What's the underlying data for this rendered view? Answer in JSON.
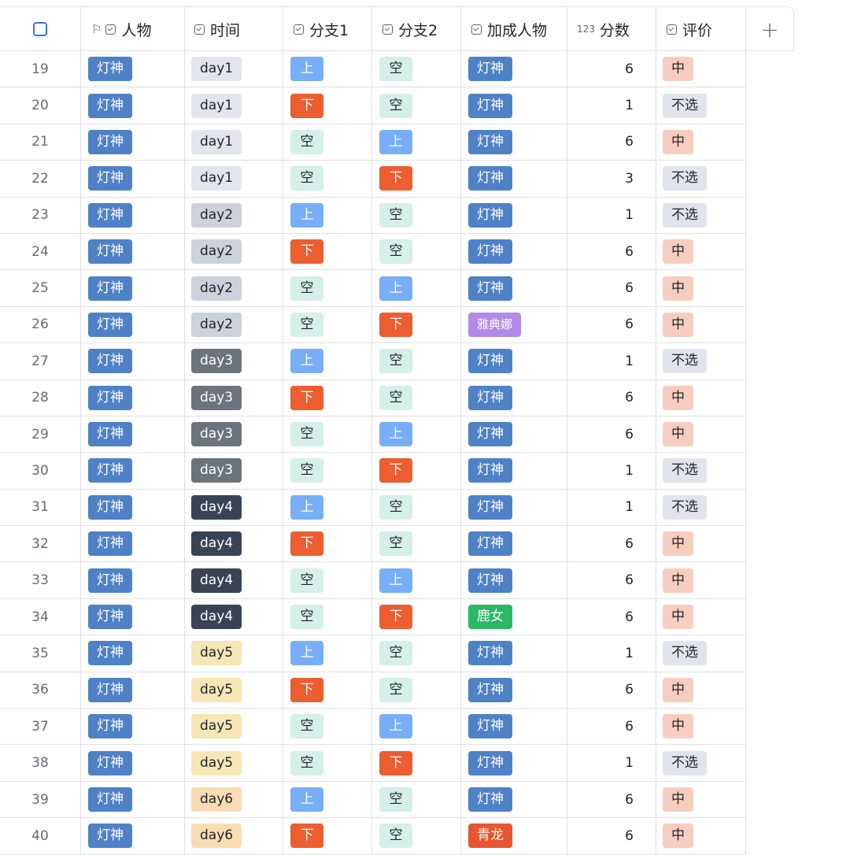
{
  "header": {
    "columns": [
      {
        "key": "select",
        "label": ""
      },
      {
        "key": "person",
        "label": "人物"
      },
      {
        "key": "time",
        "label": "时间"
      },
      {
        "key": "branch1",
        "label": "分支1"
      },
      {
        "key": "branch2",
        "label": "分支2"
      },
      {
        "key": "bonus",
        "label": "加成人物"
      },
      {
        "key": "score",
        "label": "分数",
        "type_icon": "123"
      },
      {
        "key": "rating",
        "label": "评价"
      },
      {
        "key": "add",
        "label": "+"
      }
    ]
  },
  "tag_colors": {
    "灯神": {
      "bg": "#4f81c7",
      "fg": "#ffffff"
    },
    "雅典娜": {
      "bg": "#b28ae8",
      "fg": "#ffffff"
    },
    "鹿女": {
      "bg": "#2bb866",
      "fg": "#ffffff"
    },
    "青龙": {
      "bg": "#e8562f",
      "fg": "#ffffff"
    },
    "day1": {
      "bg": "#e2e6ec",
      "fg": "#1f2329"
    },
    "day2": {
      "bg": "#cdd1d9",
      "fg": "#1f2329"
    },
    "day3": {
      "bg": "#6c737d",
      "fg": "#ffffff"
    },
    "day4": {
      "bg": "#384356",
      "fg": "#ffffff"
    },
    "day5": {
      "bg": "#f6e7b5",
      "fg": "#1f2329"
    },
    "day6": {
      "bg": "#fadcb2",
      "fg": "#1f2329"
    },
    "上": {
      "bg": "#78aef8",
      "fg": "#ffffff"
    },
    "下": {
      "bg": "#ec5d30",
      "fg": "#ffffff"
    },
    "空": {
      "bg": "#d5efe9",
      "fg": "#1f2329"
    },
    "中": {
      "bg": "#f7cdc0",
      "fg": "#1f2329"
    },
    "不选": {
      "bg": "#e1e5eb",
      "fg": "#1f2329"
    }
  },
  "rows": [
    {
      "num": "19",
      "person": "灯神",
      "time": "day1",
      "b1": "上",
      "b2": "空",
      "bonus": "灯神",
      "score": "6",
      "rating": "中"
    },
    {
      "num": "20",
      "person": "灯神",
      "time": "day1",
      "b1": "下",
      "b2": "空",
      "bonus": "灯神",
      "score": "1",
      "rating": "不选"
    },
    {
      "num": "21",
      "person": "灯神",
      "time": "day1",
      "b1": "空",
      "b2": "上",
      "bonus": "灯神",
      "score": "6",
      "rating": "中"
    },
    {
      "num": "22",
      "person": "灯神",
      "time": "day1",
      "b1": "空",
      "b2": "下",
      "bonus": "灯神",
      "score": "3",
      "rating": "不选"
    },
    {
      "num": "23",
      "person": "灯神",
      "time": "day2",
      "b1": "上",
      "b2": "空",
      "bonus": "灯神",
      "score": "1",
      "rating": "不选"
    },
    {
      "num": "24",
      "person": "灯神",
      "time": "day2",
      "b1": "下",
      "b2": "空",
      "bonus": "灯神",
      "score": "6",
      "rating": "中"
    },
    {
      "num": "25",
      "person": "灯神",
      "time": "day2",
      "b1": "空",
      "b2": "上",
      "bonus": "灯神",
      "score": "6",
      "rating": "中"
    },
    {
      "num": "26",
      "person": "灯神",
      "time": "day2",
      "b1": "空",
      "b2": "下",
      "bonus": "雅典娜",
      "score": "6",
      "rating": "中"
    },
    {
      "num": "27",
      "person": "灯神",
      "time": "day3",
      "b1": "上",
      "b2": "空",
      "bonus": "灯神",
      "score": "1",
      "rating": "不选"
    },
    {
      "num": "28",
      "person": "灯神",
      "time": "day3",
      "b1": "下",
      "b2": "空",
      "bonus": "灯神",
      "score": "6",
      "rating": "中"
    },
    {
      "num": "29",
      "person": "灯神",
      "time": "day3",
      "b1": "空",
      "b2": "上",
      "bonus": "灯神",
      "score": "6",
      "rating": "中"
    },
    {
      "num": "30",
      "person": "灯神",
      "time": "day3",
      "b1": "空",
      "b2": "下",
      "bonus": "灯神",
      "score": "1",
      "rating": "不选"
    },
    {
      "num": "31",
      "person": "灯神",
      "time": "day4",
      "b1": "上",
      "b2": "空",
      "bonus": "灯神",
      "score": "1",
      "rating": "不选"
    },
    {
      "num": "32",
      "person": "灯神",
      "time": "day4",
      "b1": "下",
      "b2": "空",
      "bonus": "灯神",
      "score": "6",
      "rating": "中"
    },
    {
      "num": "33",
      "person": "灯神",
      "time": "day4",
      "b1": "空",
      "b2": "上",
      "bonus": "灯神",
      "score": "6",
      "rating": "中"
    },
    {
      "num": "34",
      "person": "灯神",
      "time": "day4",
      "b1": "空",
      "b2": "下",
      "bonus": "鹿女",
      "score": "6",
      "rating": "中"
    },
    {
      "num": "35",
      "person": "灯神",
      "time": "day5",
      "b1": "上",
      "b2": "空",
      "bonus": "灯神",
      "score": "1",
      "rating": "不选"
    },
    {
      "num": "36",
      "person": "灯神",
      "time": "day5",
      "b1": "下",
      "b2": "空",
      "bonus": "灯神",
      "score": "6",
      "rating": "中"
    },
    {
      "num": "37",
      "person": "灯神",
      "time": "day5",
      "b1": "空",
      "b2": "上",
      "bonus": "灯神",
      "score": "6",
      "rating": "中"
    },
    {
      "num": "38",
      "person": "灯神",
      "time": "day5",
      "b1": "空",
      "b2": "下",
      "bonus": "灯神",
      "score": "1",
      "rating": "不选"
    },
    {
      "num": "39",
      "person": "灯神",
      "time": "day6",
      "b1": "上",
      "b2": "空",
      "bonus": "灯神",
      "score": "6",
      "rating": "中"
    },
    {
      "num": "40",
      "person": "灯神",
      "time": "day6",
      "b1": "下",
      "b2": "空",
      "bonus": "青龙",
      "score": "6",
      "rating": "中"
    }
  ]
}
